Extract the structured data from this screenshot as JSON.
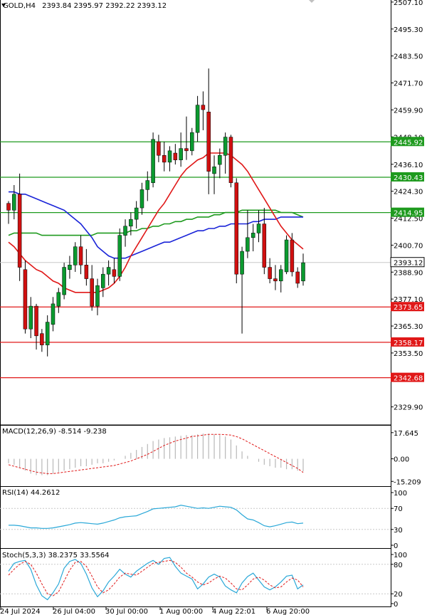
{
  "header": {
    "symbol": "GOLD,H4",
    "ohlc": "2393.84 2395.97 2392.22 2393.12"
  },
  "colors": {
    "bull": "#0b9a2f",
    "bear": "#d01010",
    "sma_fast": "#e01818",
    "sma_mid": "#1a24d8",
    "sma_slow": "#1e9a1e",
    "support": "#e01818",
    "resistance": "#1e9a1e",
    "grid": "#bfbfbf"
  },
  "x_labels": [
    "24 Jul 2024",
    "26 Jul 04:00",
    "30 Jul 00:00",
    "1 Aug 00:00",
    "4 Aug 22:01",
    "6 Aug 20:00"
  ],
  "price_panel": {
    "y_ticks": [
      "2507.10",
      "2495.30",
      "2483.50",
      "2471.70",
      "2459.90",
      "2448.10",
      "2436.10",
      "2424.30",
      "2412.50",
      "2400.70",
      "2388.90",
      "2377.10",
      "2365.30",
      "2353.50",
      "2329.90"
    ],
    "current_price": "2393.12",
    "resistance_levels": [
      "2445.92",
      "2430.43",
      "2414.95"
    ],
    "support_levels": [
      "2373.65",
      "2358.17",
      "2342.68"
    ]
  },
  "macd_panel": {
    "title": "MACD(12,26,9) -8.514 -9.238",
    "y_ticks": [
      "17.645",
      "0.00",
      "-15.209"
    ]
  },
  "rsi_panel": {
    "title": "RSI(14) 44.2612",
    "y_ticks": [
      "100",
      "70",
      "30",
      "0"
    ]
  },
  "stoch_panel": {
    "title": "Stoch(5,3,3) 38.2375 33.5564",
    "y_ticks": [
      "100",
      "80",
      "20",
      "0"
    ]
  },
  "chart_data": {
    "type": "candlestick",
    "ylim": [
      2322,
      2508
    ],
    "candles": [
      [
        2419,
        2420,
        2410,
        2416
      ],
      [
        2416,
        2427,
        2412,
        2423
      ],
      [
        2423,
        2432,
        2385,
        2391
      ],
      [
        2390,
        2394,
        2362,
        2364
      ],
      [
        2364,
        2378,
        2360,
        2374
      ],
      [
        2374,
        2375,
        2355,
        2361
      ],
      [
        2362,
        2364,
        2354,
        2357
      ],
      [
        2357,
        2370,
        2352,
        2367
      ],
      [
        2366,
        2378,
        2363,
        2375
      ],
      [
        2374,
        2382,
        2371,
        2380
      ],
      [
        2379,
        2393,
        2377,
        2391
      ],
      [
        2390,
        2396,
        2386,
        2392
      ],
      [
        2392,
        2402,
        2389,
        2400
      ],
      [
        2400,
        2405,
        2388,
        2392
      ],
      [
        2392,
        2399,
        2383,
        2386
      ],
      [
        2386,
        2392,
        2372,
        2374
      ],
      [
        2374,
        2386,
        2370,
        2383
      ],
      [
        2382,
        2391,
        2378,
        2388
      ],
      [
        2388,
        2394,
        2383,
        2391
      ],
      [
        2390,
        2395,
        2384,
        2387
      ],
      [
        2387,
        2408,
        2385,
        2405
      ],
      [
        2405,
        2412,
        2400,
        2409
      ],
      [
        2409,
        2415,
        2405,
        2412
      ],
      [
        2412,
        2420,
        2408,
        2417
      ],
      [
        2417,
        2428,
        2414,
        2425
      ],
      [
        2425,
        2433,
        2420,
        2429
      ],
      [
        2428,
        2450,
        2426,
        2447
      ],
      [
        2446,
        2449,
        2437,
        2440
      ],
      [
        2440,
        2446,
        2433,
        2437
      ],
      [
        2437,
        2444,
        2433,
        2442
      ],
      [
        2441,
        2445,
        2436,
        2438
      ],
      [
        2438,
        2450,
        2435,
        2443
      ],
      [
        2443,
        2457,
        2438,
        2442
      ],
      [
        2442,
        2452,
        2440,
        2450
      ],
      [
        2450,
        2466,
        2446,
        2462
      ],
      [
        2462,
        2468,
        2451,
        2460
      ],
      [
        2459,
        2478,
        2423,
        2433
      ],
      [
        2432,
        2440,
        2423,
        2435
      ],
      [
        2436,
        2443,
        2430,
        2440
      ],
      [
        2440,
        2450,
        2432,
        2448
      ],
      [
        2448,
        2449,
        2426,
        2428
      ],
      [
        2428,
        2430,
        2384,
        2388
      ],
      [
        2388,
        2400,
        2362,
        2398
      ],
      [
        2398,
        2416,
        2395,
        2404
      ],
      [
        2404,
        2410,
        2398,
        2406
      ],
      [
        2406,
        2416,
        2402,
        2410
      ],
      [
        2410,
        2417,
        2388,
        2391
      ],
      [
        2391,
        2395,
        2384,
        2386
      ],
      [
        2386,
        2392,
        2381,
        2385
      ],
      [
        2385,
        2392,
        2380,
        2390
      ],
      [
        2389,
        2405,
        2388,
        2403
      ],
      [
        2403,
        2406,
        2387,
        2389
      ],
      [
        2389,
        2391,
        2382,
        2384
      ],
      [
        2385,
        2397,
        2383,
        2393
      ]
    ],
    "sma_fast": [
      2402,
      2400,
      2397,
      2394,
      2392,
      2390,
      2389,
      2387,
      2385,
      2384,
      2382,
      2381,
      2380,
      2380,
      2380,
      2380,
      2380,
      2381,
      2382,
      2384,
      2387,
      2391,
      2396,
      2400,
      2404,
      2408,
      2412,
      2416,
      2419,
      2423,
      2427,
      2431,
      2434,
      2436,
      2438,
      2439,
      2441,
      2441,
      2441,
      2441,
      2440,
      2438,
      2436,
      2433,
      2429,
      2425,
      2421,
      2417,
      2413,
      2409,
      2406,
      2403,
      2401,
      2399
    ],
    "sma_mid": [
      2424,
      2424,
      2423,
      2423,
      2422,
      2421,
      2420,
      2419,
      2418,
      2417,
      2416,
      2414,
      2412,
      2410,
      2407,
      2404,
      2400,
      2398,
      2396,
      2395,
      2395,
      2395,
      2396,
      2397,
      2398,
      2399,
      2400,
      2401,
      2402,
      2402,
      2403,
      2404,
      2405,
      2406,
      2407,
      2407,
      2408,
      2408,
      2409,
      2409,
      2410,
      2410,
      2410,
      2410,
      2411,
      2411,
      2412,
      2412,
      2412,
      2413,
      2413,
      2413,
      2413,
      2413
    ],
    "sma_slow": [
      2405,
      2406,
      2406,
      2406,
      2406,
      2406,
      2405,
      2405,
      2405,
      2405,
      2405,
      2405,
      2405,
      2405,
      2405,
      2405,
      2406,
      2406,
      2406,
      2406,
      2406,
      2406,
      2407,
      2407,
      2408,
      2408,
      2409,
      2409,
      2410,
      2410,
      2411,
      2411,
      2412,
      2412,
      2413,
      2413,
      2413,
      2414,
      2414,
      2415,
      2415,
      2415,
      2416,
      2416,
      2416,
      2416,
      2416,
      2416,
      2416,
      2415,
      2415,
      2415,
      2414,
      2413
    ],
    "macd_hist": [
      -3,
      -4,
      -6,
      -8,
      -10,
      -11,
      -11,
      -11,
      -10,
      -9,
      -8,
      -7,
      -6,
      -5,
      -5,
      -4,
      -3,
      -3,
      -2,
      -1,
      0,
      2,
      4,
      6,
      8,
      10,
      12,
      13,
      14,
      14.5,
      15,
      15.5,
      16,
      16,
      16.5,
      17,
      17,
      16.5,
      16,
      15,
      13,
      9,
      5,
      2,
      0,
      -2,
      -4,
      -5,
      -6,
      -6,
      -7,
      -7,
      -8,
      -8.5
    ],
    "macd_signal": [
      -4,
      -5,
      -6,
      -7,
      -8,
      -9,
      -9.5,
      -10,
      -10,
      -9.5,
      -9,
      -8.5,
      -8,
      -7.5,
      -7,
      -6.5,
      -6,
      -5.5,
      -5,
      -4.5,
      -3.5,
      -2.5,
      -1.5,
      0,
      1.5,
      3,
      5,
      7,
      9,
      10.5,
      12,
      13,
      14,
      15,
      15.5,
      16,
      16.5,
      16.5,
      16.5,
      16.3,
      16,
      15,
      13.5,
      11.5,
      9.5,
      7.5,
      5.5,
      3.5,
      1.5,
      -0.5,
      -2.5,
      -4.5,
      -6.5,
      -9.2
    ],
    "rsi": [
      38,
      38,
      37,
      35,
      33,
      33,
      32,
      32,
      33,
      35,
      37,
      39,
      42,
      43,
      42,
      41,
      40,
      42,
      45,
      48,
      52,
      54,
      55,
      56,
      60,
      64,
      69,
      70,
      71,
      72,
      73,
      76,
      74,
      72,
      70,
      71,
      70,
      72,
      74,
      73,
      72,
      67,
      58,
      50,
      48,
      43,
      37,
      35,
      37,
      40,
      43,
      44,
      41,
      42
    ],
    "stoch_k": [
      66,
      82,
      86,
      88,
      70,
      38,
      16,
      8,
      22,
      40,
      72,
      86,
      90,
      82,
      60,
      32,
      14,
      26,
      44,
      56,
      70,
      60,
      54,
      66,
      74,
      82,
      88,
      80,
      92,
      94,
      76,
      62,
      56,
      50,
      30,
      40,
      54,
      60,
      54,
      36,
      28,
      22,
      42,
      55,
      62,
      48,
      34,
      28,
      34,
      44,
      56,
      58,
      30,
      38
    ],
    "stoch_d": [
      58,
      70,
      80,
      86,
      80,
      62,
      40,
      20,
      16,
      24,
      46,
      68,
      84,
      86,
      76,
      56,
      34,
      22,
      28,
      40,
      54,
      62,
      60,
      58,
      66,
      74,
      82,
      84,
      86,
      88,
      84,
      74,
      62,
      54,
      44,
      38,
      42,
      50,
      56,
      52,
      42,
      30,
      28,
      38,
      50,
      54,
      48,
      38,
      32,
      34,
      44,
      52,
      48,
      34
    ]
  }
}
